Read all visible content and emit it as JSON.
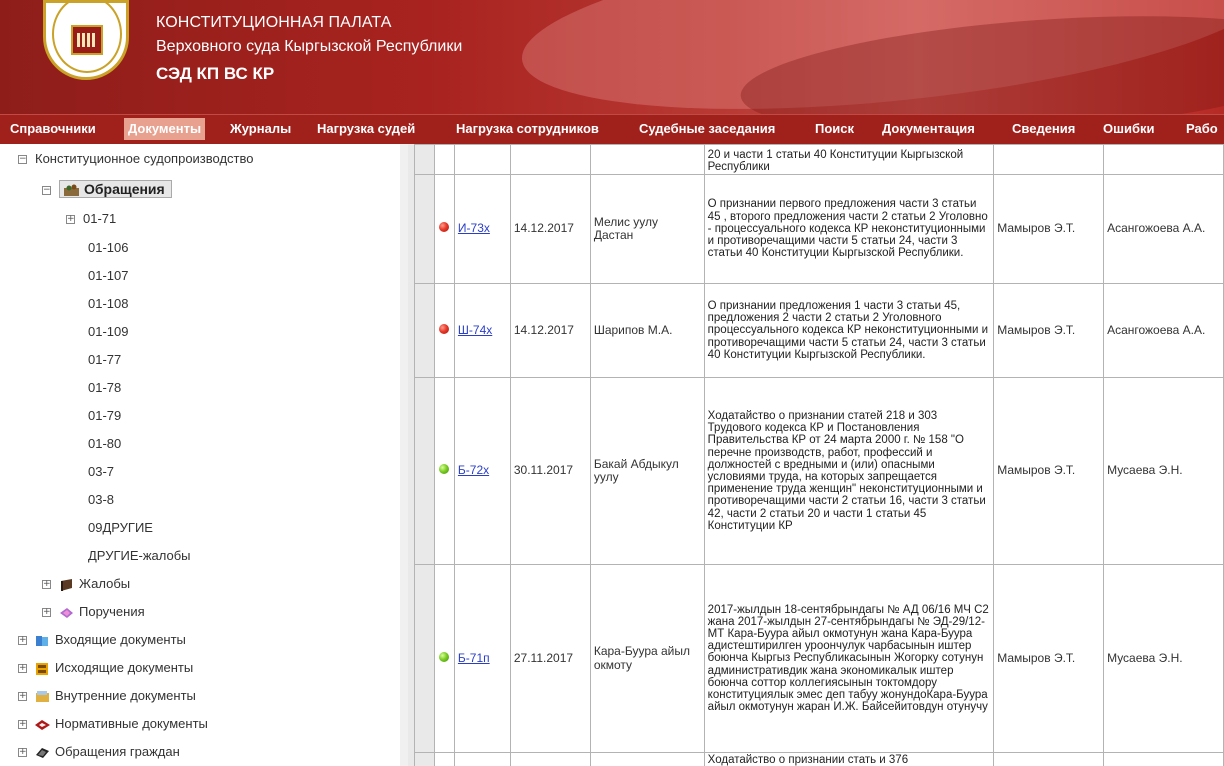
{
  "header": {
    "line1": "КОНСТИТУЦИОННАЯ ПАЛАТА",
    "line2": "Верховного суда Кыргызской Республики",
    "line3": "СЭД КП ВС КР"
  },
  "menu": [
    {
      "label": "Справочники"
    },
    {
      "label": "Документы"
    },
    {
      "label": "Журналы"
    },
    {
      "label": "Нагрузка судей"
    },
    {
      "label": "Нагрузка сотрудников"
    },
    {
      "label": "Судебные заседания"
    },
    {
      "label": "Поиск"
    },
    {
      "label": "Документация"
    },
    {
      "label": "Сведения"
    },
    {
      "label": "Ошибки"
    },
    {
      "label": "Рабо"
    }
  ],
  "tree": {
    "root": "Конституционное судопроизводство",
    "selected": "Обращения",
    "children": [
      "01-71",
      "01-106",
      "01-107",
      "01-108",
      "01-109",
      "01-77",
      "01-78",
      "01-79",
      "01-80",
      "03-7",
      "03-8",
      "09ДРУГИЕ",
      "ДРУГИЕ-жалобы"
    ],
    "zhaloby": "Жалобы",
    "porucheniya": "Поручения",
    "sections": [
      "Входящие документы",
      "Исходящие документы",
      "Внутренние документы",
      "Нормативные документы",
      "Обращения граждан"
    ]
  },
  "table": {
    "top_partial": "20 и части 1 статьи 40 Конституции Кыргызской Республики",
    "rows": [
      {
        "status": "red",
        "num": "И-73х",
        "date": "14.12.2017",
        "applicant": "Мелис уулу Дастан",
        "desc": "О признании первого предложения части 3 статьи 45 , второго предложения части 2 статьи 2 Уголовно - процессуального кодекса КР неконституционными и противоречащими части 5 статьи 24, части 3 статьи 40 Конституции Кыргызской Республики.",
        "judge": "Мамыров Э.Т.",
        "employee": "Асангожоева А.А."
      },
      {
        "status": "red",
        "num": "Ш-74х",
        "date": "14.12.2017",
        "applicant": "Шарипов М.А.",
        "desc": "О признании предложения 1 части 3 статьи 45, предложения 2 части 2 статьи 2 Уголовного процессуального кодекса КР неконституционными и противоречащими части 5 статьи 24, части 3 статьи 40 Конституции Кыргызской Республики.",
        "judge": "Мамыров Э.Т.",
        "employee": "Асангожоева А.А."
      },
      {
        "status": "green",
        "num": "Б-72х",
        "date": "30.11.2017",
        "applicant": "Бакай Абдыкул уулу",
        "desc": "Ходатайство о признании статей 218 и 303 Трудового кодекса КР и Постановления Правительства КР от 24 марта 2000 г. № 158 \"О перечне производств, работ, профессий и должностей с вредными и (или) опасными условиями труда, на которых запрещается применение труда женщин\" неконституционными и противоречащими части 2 статьи 16, части 3 статьи 42, части 2 статьи 20 и части 1 статьи 45 Конституции КР",
        "judge": "Мамыров Э.Т.",
        "employee": "Мусаева Э.Н."
      },
      {
        "status": "green",
        "num": "Б-71п",
        "date": "27.11.2017",
        "applicant": "Кара-Буура айыл окмоту",
        "desc": "2017-жылдын 18-сентябрындагы № АД 06/16 МЧ С2 жана 2017-жылдын 27-сентябрындагы № ЭД-29/12-МТ Кара-Буура айыл окмотунун жана Кара-Буура адистештирилген уроончулук чарбасынын иштер боюнча Кыргыз Республикасынын Жогорку сотунун административдик жана экономикалык иштер боюнча соттор коллегиясынын токтомдору конституциялык эмес деп табуу жонундоКара-Буура айыл окмотунун жаран И.Ж. Байсейитовдун отунучу",
        "judge": "Мамыров Э.Т.",
        "employee": "Мусаева Э.Н."
      }
    ],
    "bottom_partial": "Ходатайство о признании стать и 376"
  }
}
